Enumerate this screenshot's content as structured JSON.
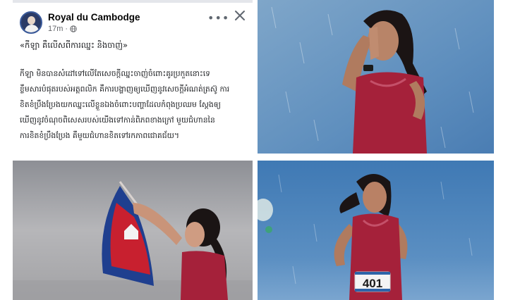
{
  "post": {
    "page_name": "Royal du Cambodge",
    "time": "17m",
    "separator": "·",
    "more_label": "•••",
    "headline": "«កីឡា គឺលើសពីការឈ្នះ និងចាញ់»",
    "body_lines": [
      "កីឡា មិនបានសំដៅទៅលើតែសេចក្ដីឈ្នះចាញ់ចំពោះគូរប្រកួតនោះទេ",
      "ខ្លឹមសារបំផុតរបស់អត្តពលិក គឺការបង្ហាញឲ្យឃើញនូវសេចក្ដីអំណត់ត្រស៊ូ ការ",
      "ខិតខំប្រឹងប្រែងយកឈ្នះលើខ្លួនឯងចំពោះបញ្ហាដែលកំពុងប្រឈម ស្ដែងឲ្យ",
      "ឃើញនូវចំណុចពិសេសរបស់យើងទៅកាន់ពិភពខាងក្រៅ មួយជំហាននៃ",
      "ការខិតខំប្រឹងប្រែង គឺមួយជំហានខិតទៅរកភាពជោគជ័យ។"
    ],
    "icons": {
      "avatar": "page-avatar",
      "globe": "globe-icon",
      "more": "more-options-icon",
      "close": "close-icon"
    }
  },
  "photos": {
    "top_right": {
      "subject": "athlete-praying-in-rain"
    },
    "bottom_left": {
      "subject": "athlete-with-cambodian-flag"
    },
    "bottom_right": {
      "subject": "athlete-running-in-rain",
      "bib_number": "401"
    }
  },
  "colors": {
    "jersey": "#a5213a",
    "flag_blue": "#1f3f8f",
    "flag_red": "#c8202f",
    "stadium_blue": "#3f79b4"
  }
}
